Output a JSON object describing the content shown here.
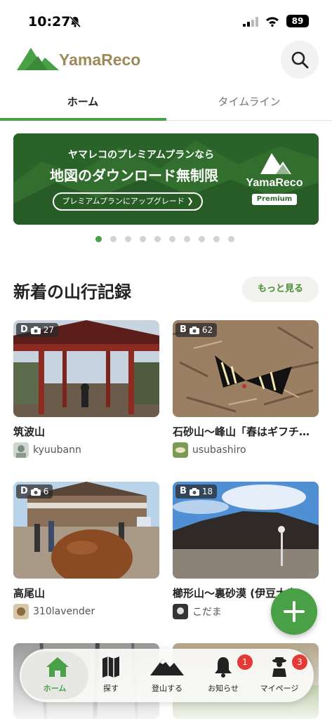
{
  "status_bar": {
    "time": "10:27",
    "battery": "89",
    "icons": [
      "bell-slash-icon",
      "signal-icon",
      "wifi-icon",
      "battery-icon"
    ]
  },
  "header": {
    "logo_text": "YamaReco",
    "search_icon": "search-icon"
  },
  "tabs": [
    {
      "label": "ホーム",
      "active": true
    },
    {
      "label": "タイムライン",
      "active": false
    }
  ],
  "banner": {
    "line1": "ヤマレコのプレミアムプランなら",
    "line2": "地図のダウンロード無制限",
    "cta": "プレミアムプランにアップグレード ❯",
    "brand": "YamaReco",
    "premium": "Premium"
  },
  "carousel": {
    "count": 10,
    "active_index": 0
  },
  "section": {
    "title": "新着の山行記録",
    "more_label": "もっと見る"
  },
  "records": [
    {
      "grade": "D",
      "photos": "27",
      "title": "筑波山",
      "user": "kyuubann"
    },
    {
      "grade": "B",
      "photos": "62",
      "title": "石砂山〜峰山「春はギフチ…",
      "user": "usubashiro"
    },
    {
      "grade": "D",
      "photos": "6",
      "title": "高尾山",
      "user": "310lavender"
    },
    {
      "grade": "B",
      "photos": "18",
      "title": "櫛形山〜裏砂漠 (伊豆大島)",
      "user": "こだま"
    }
  ],
  "fab": {
    "icon": "plus-icon"
  },
  "bottom_nav": [
    {
      "label": "ホーム",
      "icon": "home-icon",
      "active": true,
      "badge": ""
    },
    {
      "label": "探す",
      "icon": "map-icon",
      "active": false,
      "badge": ""
    },
    {
      "label": "登山する",
      "icon": "mountain-icon",
      "active": false,
      "badge": ""
    },
    {
      "label": "お知らせ",
      "icon": "bell-icon",
      "active": false,
      "badge": "1"
    },
    {
      "label": "マイページ",
      "icon": "hiker-icon",
      "active": false,
      "badge": "3"
    }
  ],
  "colors": {
    "accent": "#4aa047",
    "badge": "#e53935",
    "banner": "#2f6f2f"
  }
}
